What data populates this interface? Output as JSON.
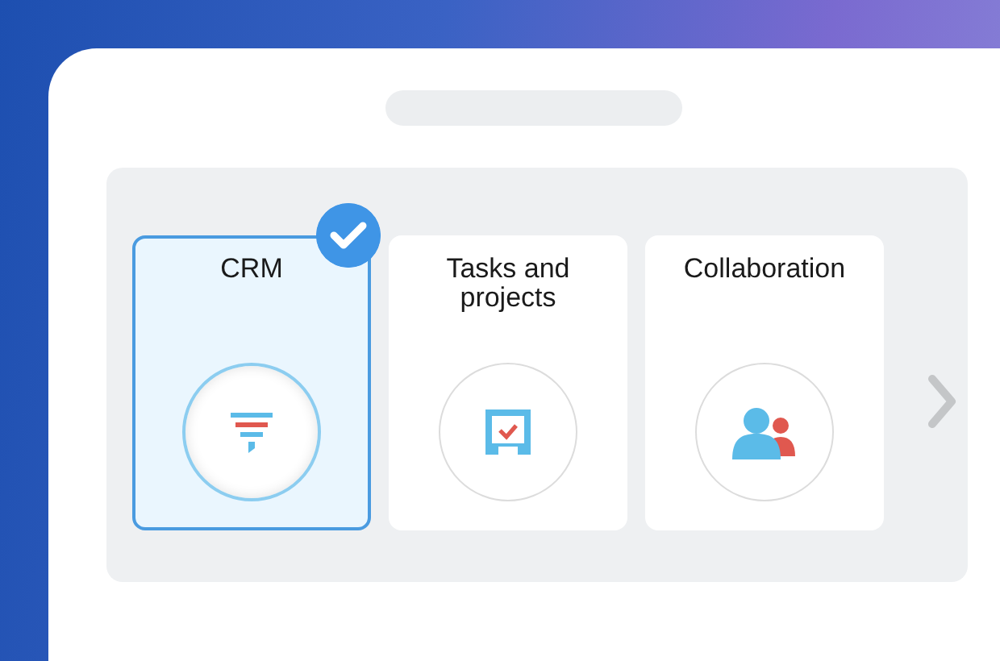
{
  "cards": [
    {
      "label": "CRM",
      "kind": "funnel",
      "selected": true
    },
    {
      "label": "Tasks and projects",
      "kind": "inbox",
      "selected": false
    },
    {
      "label": "Collaboration",
      "kind": "people",
      "selected": false
    }
  ]
}
